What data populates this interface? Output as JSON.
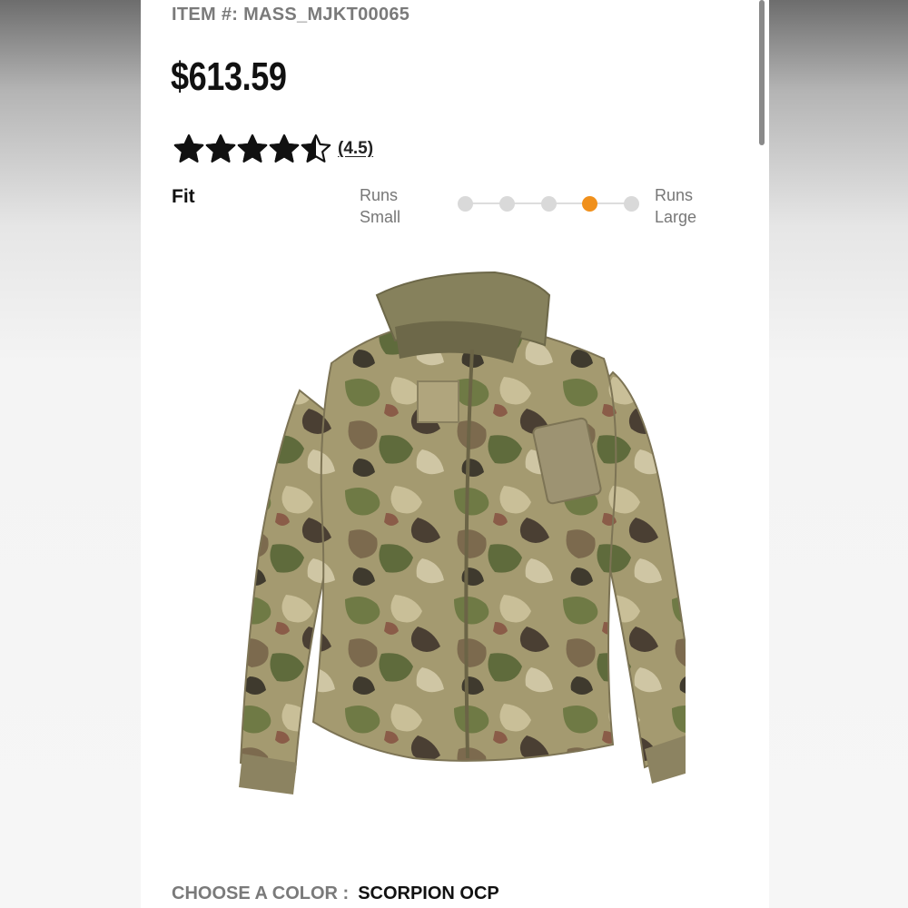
{
  "product": {
    "item_number": "ITEM #: MASS_MJKT00065",
    "price": "$613.59",
    "rating": {
      "value": 4.5,
      "max": 5,
      "count_text": "(4.5)"
    },
    "fit": {
      "label": "Fit",
      "min_label_line1": "Runs",
      "min_label_line2": "Small",
      "max_label_line1": "Runs",
      "max_label_line2": "Large",
      "steps": 5,
      "selected_step": 4
    },
    "image": {
      "icon": "camouflage-fleece-jacket"
    },
    "color": {
      "label": "CHOOSE A COLOR :",
      "selected": "SCORPION OCP"
    }
  },
  "colors": {
    "accent": "#f0901c",
    "text_muted": "#7a7a7a",
    "text_dark": "#111111"
  }
}
